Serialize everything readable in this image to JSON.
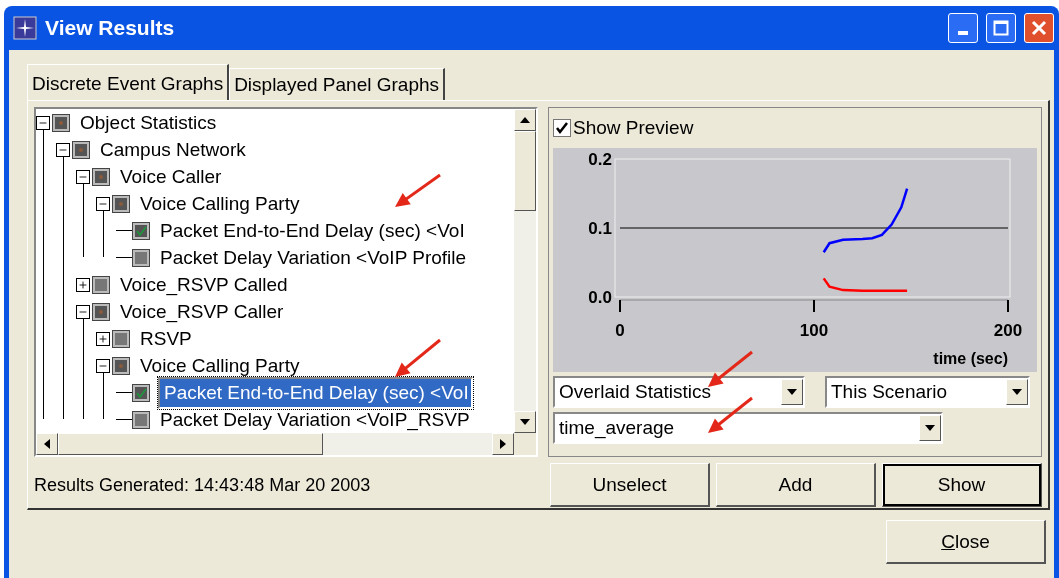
{
  "window": {
    "title": "View Results"
  },
  "tabs": [
    {
      "label": "Discrete Event Graphs",
      "selected": true
    },
    {
      "label": "Displayed Panel Graphs",
      "selected": false
    }
  ],
  "tree": [
    {
      "label": "Object Statistics",
      "checked": false,
      "partial": true,
      "expanded": true,
      "selected": false,
      "children": [
        {
          "label": "Campus Network",
          "checked": false,
          "partial": true,
          "expanded": true,
          "selected": false,
          "children": [
            {
              "label": "Voice Caller",
              "checked": false,
              "partial": true,
              "expanded": true,
              "selected": false,
              "children": [
                {
                  "label": "Voice Calling Party",
                  "checked": false,
                  "partial": true,
                  "expanded": true,
                  "selected": false,
                  "children": [
                    {
                      "label": "Packet End-to-End Delay (sec) <VoI",
                      "checked": true,
                      "partial": false,
                      "selected": false
                    },
                    {
                      "label": "Packet Delay Variation <VoIP Profile",
                      "checked": false,
                      "partial": false,
                      "selected": false
                    }
                  ]
                }
              ]
            },
            {
              "label": "Voice_RSVP Called",
              "checked": false,
              "partial": false,
              "expanded": false,
              "selected": false
            },
            {
              "label": "Voice_RSVP Caller",
              "checked": false,
              "partial": true,
              "expanded": true,
              "selected": false,
              "children": [
                {
                  "label": "RSVP",
                  "checked": false,
                  "partial": false,
                  "expanded": false,
                  "selected": false
                },
                {
                  "label": "Voice Calling Party",
                  "checked": false,
                  "partial": true,
                  "expanded": true,
                  "selected": false,
                  "children": [
                    {
                      "label": "Packet End-to-End Delay (sec) <VoI",
                      "checked": true,
                      "partial": false,
                      "selected": true
                    },
                    {
                      "label": "Packet Delay Variation <VoIP_RSVP",
                      "checked": false,
                      "partial": false,
                      "selected": false
                    }
                  ]
                }
              ]
            }
          ]
        }
      ]
    }
  ],
  "preview": {
    "label": "Show Preview",
    "checked": true
  },
  "chart_data": {
    "type": "line",
    "xlabel": "time (sec)",
    "xlim": [
      0,
      200
    ],
    "ylim": [
      0,
      0.2
    ],
    "xticks": [
      0,
      100,
      200
    ],
    "yticks": [
      {
        "value": 0,
        "label": "0.0"
      },
      {
        "value": 0.1,
        "label": "0.1"
      },
      {
        "value": 0.2,
        "label": "0.2"
      }
    ],
    "x": [
      105,
      108,
      115,
      125,
      130,
      135,
      140,
      145,
      148
    ],
    "series": [
      {
        "color": "#0000ff",
        "values": [
          0.065,
          0.078,
          0.083,
          0.084,
          0.085,
          0.09,
          0.105,
          0.13,
          0.157
        ]
      },
      {
        "color": "#ff0000",
        "values": [
          0.027,
          0.015,
          0.01,
          0.009,
          0.009,
          0.009,
          0.009,
          0.009,
          0.009
        ]
      }
    ]
  },
  "mode_select": {
    "value": "Overlaid Statistics"
  },
  "scenario_select": {
    "value": "This Scenario"
  },
  "filter_select": {
    "value": "time_average"
  },
  "status": "Results Generated: 14:43:48 Mar 20 2003",
  "buttons": [
    {
      "label": "Unselect",
      "default": false
    },
    {
      "label": "Add",
      "default": false
    },
    {
      "label": "Show",
      "default": true
    }
  ],
  "close_button": {
    "label": "Close"
  }
}
